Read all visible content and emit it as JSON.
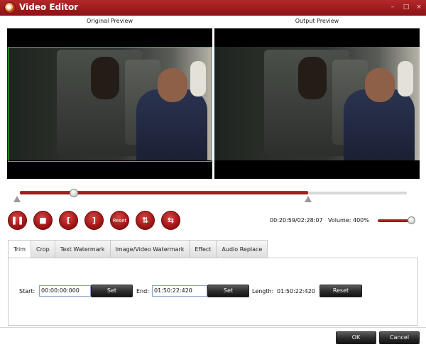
{
  "window": {
    "title": "Video Editor",
    "controls": [
      "–",
      "□",
      "×"
    ]
  },
  "preview": {
    "original_label": "Original Preview",
    "output_label": "Output Preview"
  },
  "timeline": {
    "position_fraction": 0.14,
    "trim_end_fraction": 0.745
  },
  "playback": {
    "buttons": [
      {
        "name": "pause",
        "glyph": "❚❚"
      },
      {
        "name": "stop",
        "glyph": "■"
      },
      {
        "name": "set-start",
        "glyph": "["
      },
      {
        "name": "set-end",
        "glyph": "]"
      },
      {
        "name": "reset",
        "glyph": "Reset"
      },
      {
        "name": "flip-vertical",
        "glyph": "⇅"
      },
      {
        "name": "flip-horizontal",
        "glyph": "⇆"
      }
    ],
    "time": "00:20:59/02:28:07",
    "volume_label": "Volume:",
    "volume_value": "400%",
    "volume_fraction": 0.9
  },
  "tabs": [
    "Trim",
    "Crop",
    "Text Watermark",
    "Image/Video Watermark",
    "Effect",
    "Audio Replace"
  ],
  "trim": {
    "start_label": "Start:",
    "start_value": "00:00:00:000",
    "set_label": "Set",
    "end_label": "End:",
    "end_value": "01:50:22:420",
    "length_label": "Length:",
    "length_value": "01:50:22:420",
    "reset_label": "Reset"
  },
  "footer": {
    "ok_label": "OK",
    "cancel_label": "Cancel"
  },
  "colors": {
    "accent": "#a01616",
    "crop_box": "#27d027"
  }
}
